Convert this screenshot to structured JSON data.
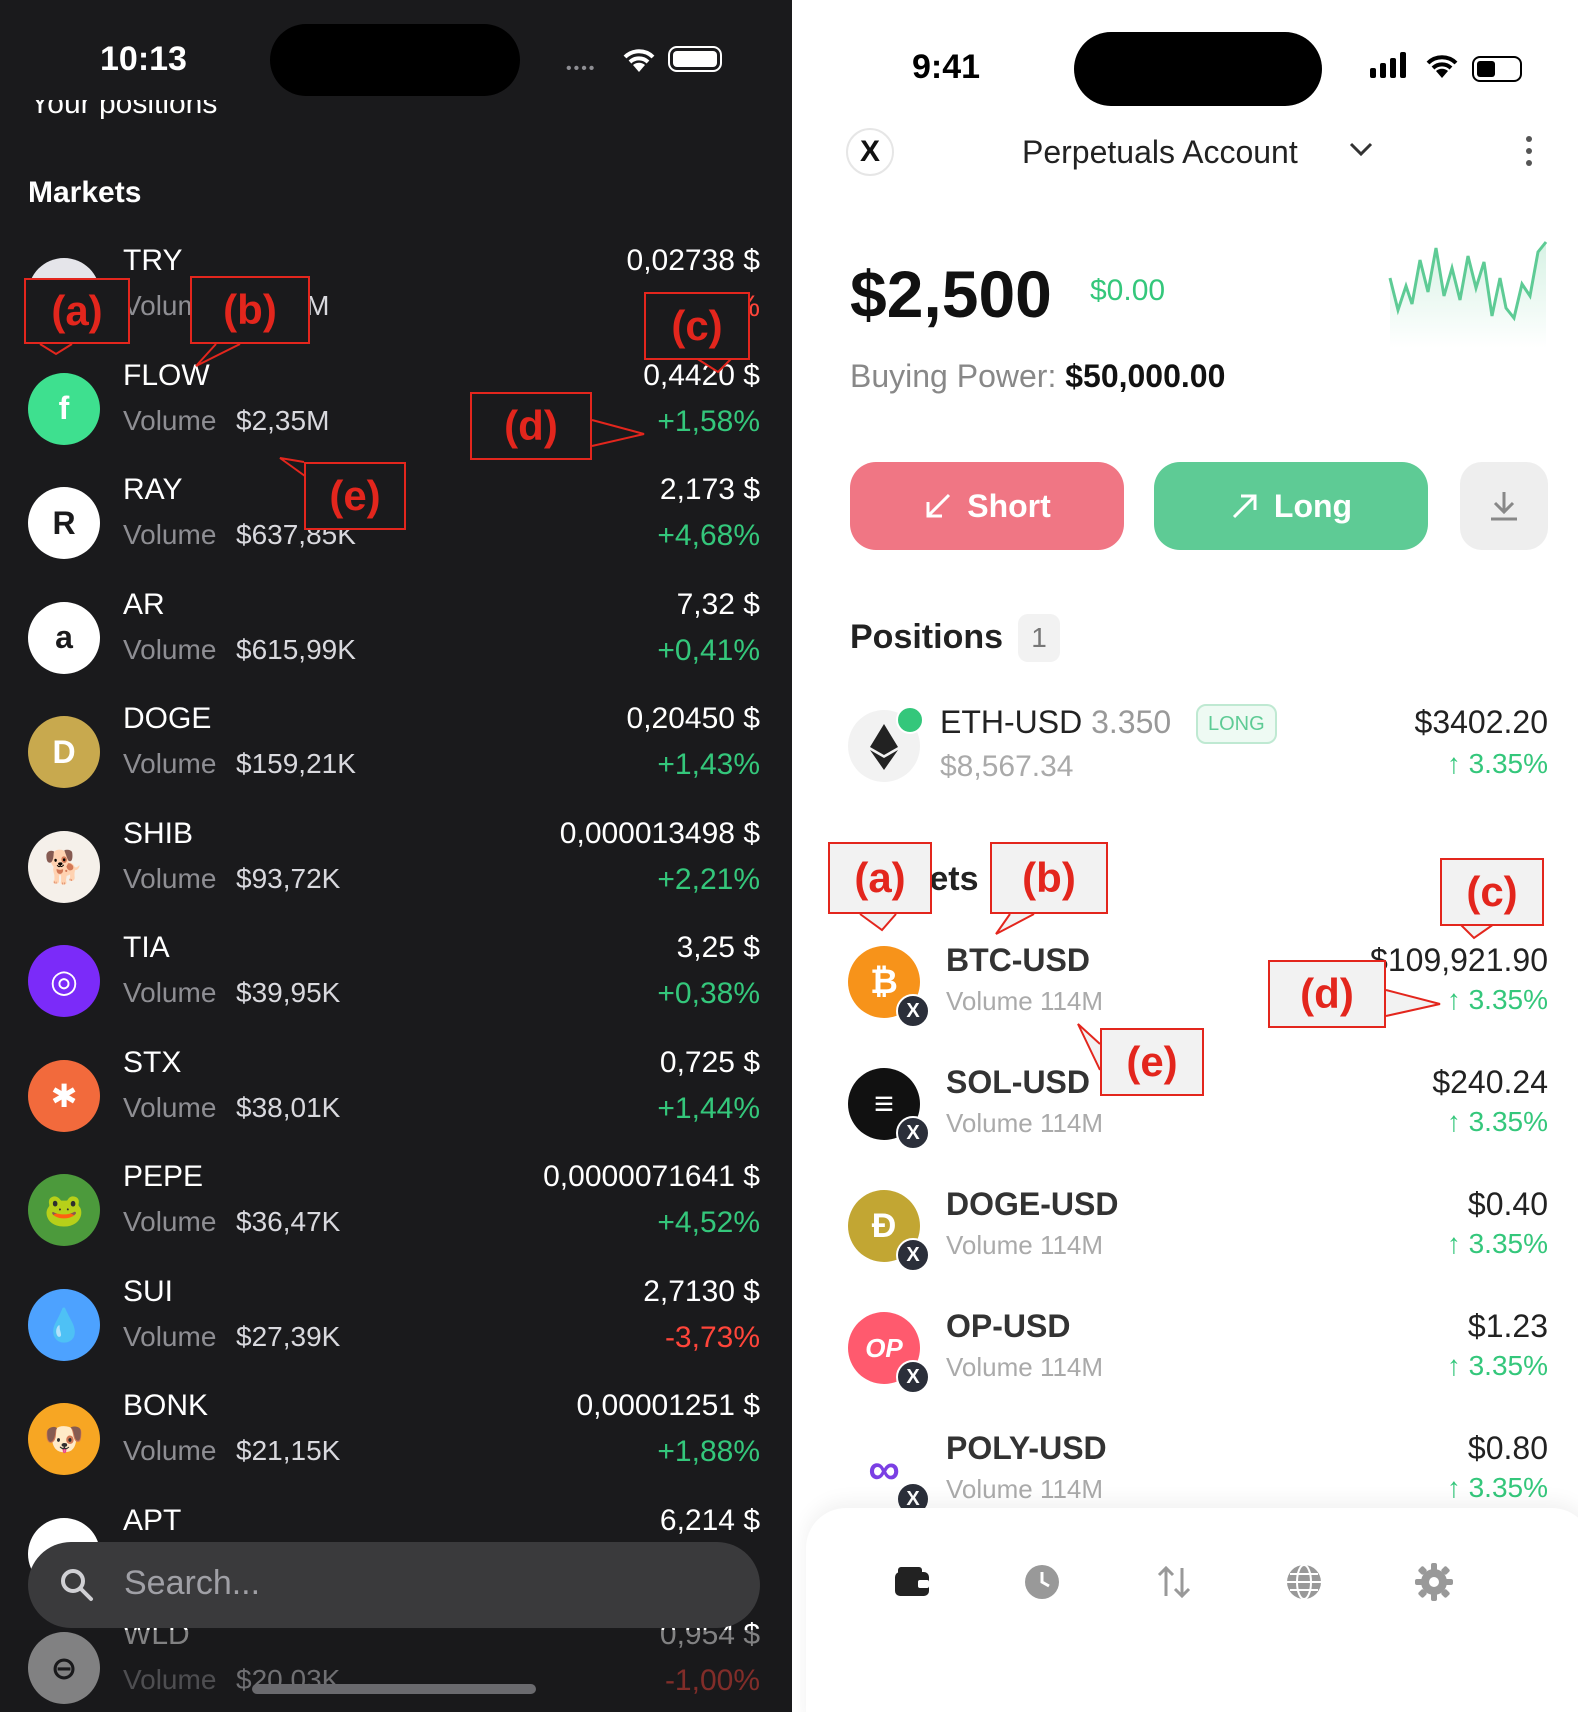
{
  "left": {
    "status": {
      "time": "10:13"
    },
    "cut_header": "Your positions",
    "section_title": "Markets",
    "volume_word": "Volume",
    "markets": [
      {
        "symbol": "TRY",
        "volume": "$2,54M",
        "price": "0,02738 $",
        "change": "-0,16%",
        "dir": "down",
        "icon": "try-token-icon",
        "color": "#e5e5ea",
        "glyph": "Tl"
      },
      {
        "symbol": "FLOW",
        "volume": "$2,35M",
        "price": "0,4420 $",
        "change": "+1,58%",
        "dir": "up",
        "icon": "flow-token-icon",
        "color": "#3ee08f",
        "glyph": "f"
      },
      {
        "symbol": "RAY",
        "volume": "$637,85K",
        "price": "2,173 $",
        "change": "+4,68%",
        "dir": "up",
        "icon": "raydium-token-icon",
        "color": "#ffffff",
        "glyph": "R"
      },
      {
        "symbol": "AR",
        "volume": "$615,99K",
        "price": "7,32 $",
        "change": "+0,41%",
        "dir": "up",
        "icon": "arweave-token-icon",
        "color": "#ffffff",
        "glyph": "a"
      },
      {
        "symbol": "DOGE",
        "volume": "$159,21K",
        "price": "0,20450 $",
        "change": "+1,43%",
        "dir": "up",
        "icon": "doge-token-icon",
        "color": "#c8a94e",
        "glyph": "D"
      },
      {
        "symbol": "SHIB",
        "volume": "$93,72K",
        "price": "0,000013498 $",
        "change": "+2,21%",
        "dir": "up",
        "icon": "shib-token-icon",
        "color": "#f5f0ea",
        "glyph": "🐕"
      },
      {
        "symbol": "TIA",
        "volume": "$39,95K",
        "price": "3,25 $",
        "change": "+0,38%",
        "dir": "up",
        "icon": "celestia-token-icon",
        "color": "#7b2bf9",
        "glyph": "◎"
      },
      {
        "symbol": "STX",
        "volume": "$38,01K",
        "price": "0,725 $",
        "change": "+1,44%",
        "dir": "up",
        "icon": "stacks-token-icon",
        "color": "#f26a3c",
        "glyph": "✱"
      },
      {
        "symbol": "PEPE",
        "volume": "$36,47K",
        "price": "0,0000071641 $",
        "change": "+4,52%",
        "dir": "up",
        "icon": "pepe-token-icon",
        "color": "#4c9a3c",
        "glyph": "🐸"
      },
      {
        "symbol": "SUI",
        "volume": "$27,39K",
        "price": "2,7130 $",
        "change": "-3,73%",
        "dir": "down",
        "icon": "sui-token-icon",
        "color": "#4da2ff",
        "glyph": "💧"
      },
      {
        "symbol": "BONK",
        "volume": "$21,15K",
        "price": "0,00001251 $",
        "change": "+1,88%",
        "dir": "up",
        "icon": "bonk-token-icon",
        "color": "#f7a623",
        "glyph": "🐶"
      },
      {
        "symbol": "APT",
        "volume": "",
        "price": "6,214 $",
        "change": "",
        "dir": "up",
        "icon": "aptos-token-icon",
        "color": "#ffffff",
        "glyph": "≡"
      },
      {
        "symbol": "WLD",
        "volume": "$20,03K",
        "price": "0,954 $",
        "change": "-1,00%",
        "dir": "down",
        "icon": "worldcoin-token-icon",
        "color": "#ffffff",
        "glyph": "⊖"
      }
    ],
    "search": {
      "placeholder": "Search..."
    }
  },
  "right": {
    "status": {
      "time": "9:41"
    },
    "header": {
      "logo": "X",
      "title": "Perpetuals Account"
    },
    "balance": {
      "amount": "$2,500",
      "change": "$0.00",
      "buying_power_label": "Buying Power:",
      "buying_power": "$50,000.00"
    },
    "actions": {
      "short": "Short",
      "long": "Long"
    },
    "positions": {
      "title": "Positions",
      "count": "1",
      "items": [
        {
          "pair": "ETH-USD",
          "amount": "3.350",
          "side": "LONG",
          "value": "$8,567.34",
          "price": "$3402.20",
          "change": "↑ 3.35%"
        }
      ]
    },
    "markets": {
      "title": "Markets",
      "items": [
        {
          "pair": "BTC-USD",
          "volume": "Volume 114M",
          "price": "$109,921.90",
          "change": "↑ 3.35%",
          "icon": "bitcoin-token-icon",
          "color": "#f7931a",
          "glyph": "₿"
        },
        {
          "pair": "SOL-USD",
          "volume": "Volume 114M",
          "price": "$240.24",
          "change": "↑ 3.35%",
          "icon": "solana-token-icon",
          "color": "#111111",
          "glyph": "≡"
        },
        {
          "pair": "DOGE-USD",
          "volume": "Volume 114M",
          "price": "$0.40",
          "change": "↑ 3.35%",
          "icon": "doge-token-icon",
          "color": "#c2a633",
          "glyph": "Ð"
        },
        {
          "pair": "OP-USD",
          "volume": "Volume 114M",
          "price": "$1.23",
          "change": "↑ 3.35%",
          "icon": "optimism-token-icon",
          "color": "#ff5a6e",
          "glyph": "OP"
        },
        {
          "pair": "POLY-USD",
          "volume": "Volume 114M",
          "price": "$0.80",
          "change": "↑ 3.35%",
          "icon": "polygon-token-icon",
          "color": "#ffffff",
          "glyph": "∞"
        }
      ]
    },
    "nav": [
      "wallet-icon",
      "history-icon",
      "transfer-icon",
      "globe-icon",
      "settings-icon"
    ]
  },
  "callouts": [
    "(a)",
    "(b)",
    "(c)",
    "(d)",
    "(e)"
  ],
  "colors": {
    "up": "#34c77b",
    "down": "#ff453a",
    "short": "#f07684",
    "long": "#5ecb95",
    "callout": "#e3261d"
  }
}
